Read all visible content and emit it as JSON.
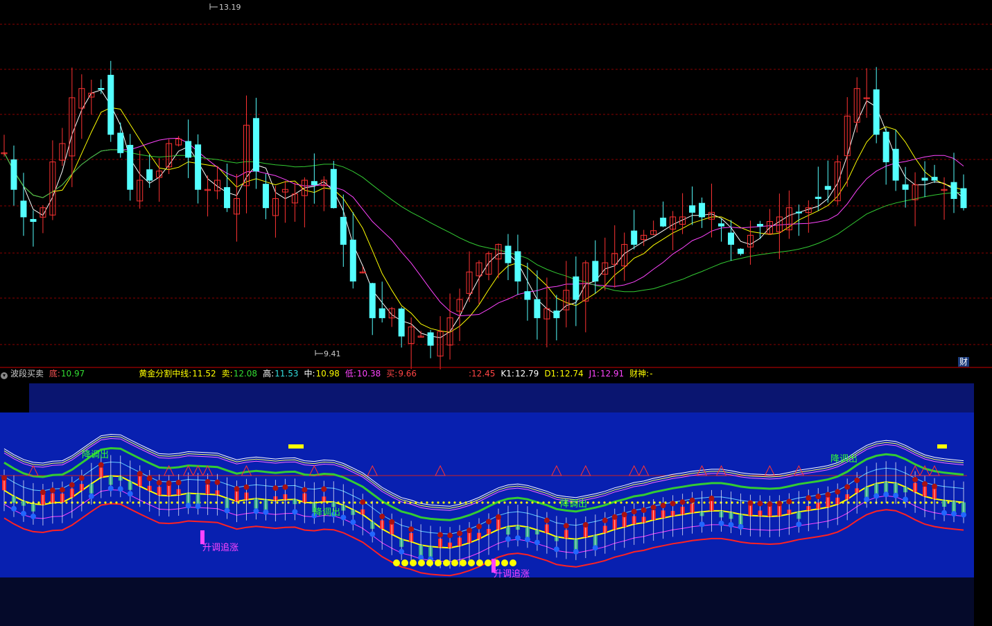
{
  "main_chart": {
    "high_label": "13.19",
    "low_label": "9.41",
    "side_badge": "财"
  },
  "indicator": {
    "name": "波段买卖",
    "items": [
      {
        "label": "底",
        "value": "10.97",
        "label_color": "#ff5555",
        "value_color": "#33dd33"
      },
      {
        "label": "黄金分割中线",
        "value": "11.52",
        "label_color": "#ffff00",
        "value_color": "#ffff00"
      },
      {
        "label": "卖",
        "value": "12.08",
        "label_color": "#ffff00",
        "value_color": "#33dd33"
      },
      {
        "label": "高",
        "value": "11.53",
        "label_color": "#ffffff",
        "value_color": "#33dddd"
      },
      {
        "label": "中",
        "value": "10.98",
        "label_color": "#ffffff",
        "value_color": "#ffff00"
      },
      {
        "label": "低",
        "value": "10.38",
        "label_color": "#ff44ff",
        "value_color": "#ff44ff"
      },
      {
        "label": "买",
        "value": "9.66",
        "label_color": "#ff4444",
        "value_color": "#ff4444"
      }
    ],
    "items2": [
      {
        "label": "",
        "value": ":12.45",
        "label_color": "#ff4444",
        "value_color": "#ff4444"
      },
      {
        "label": "K1",
        "value": "12.79",
        "label_color": "#ffffff",
        "value_color": "#ffffff"
      },
      {
        "label": "D1",
        "value": "12.74",
        "label_color": "#ffff00",
        "value_color": "#ffff00"
      },
      {
        "label": "J1",
        "value": "12.91",
        "label_color": "#ff44ff",
        "value_color": "#ff44ff"
      },
      {
        "label": "财神",
        "value": "-",
        "label_color": "#ffff00",
        "value_color": "#ffff00"
      }
    ]
  },
  "annotations": [
    {
      "text": "降调出",
      "color": "#33ff33"
    },
    {
      "text": "降调出",
      "color": "#33ff33"
    },
    {
      "text": "降调出",
      "color": "#33ff33"
    },
    {
      "text": "降调出",
      "color": "#33ff33"
    },
    {
      "text": "升调追涨",
      "color": "#ff44ff"
    },
    {
      "text": "升调追涨",
      "color": "#ff44ff"
    }
  ],
  "colors": {
    "up": "#ff3333",
    "down": "#54ffff",
    "ma5": "#ffffff",
    "ma10": "#ffff00",
    "ma20": "#ff44ff",
    "ma60": "#33cc33",
    "grid": "#8b0000",
    "panel_outer": "#0a1570",
    "panel_inner": "#0820b0"
  },
  "chart_data": {
    "type": "candlestick",
    "price_range": [
      9.41,
      13.19
    ],
    "series": [
      {
        "name": "",
        "values": [
          11.6,
          11.2,
          10.9,
          10.85,
          11.0,
          11.5,
          11.7,
          12.2,
          12.3,
          12.25,
          12.3,
          11.8,
          11.6,
          11.2,
          11.3,
          11.3,
          11.4,
          11.7,
          11.75,
          11.55,
          11.2,
          11.2,
          11.3,
          11.0,
          11.1,
          11.9,
          11.4,
          11.0,
          11.1,
          11.2,
          11.15,
          11.3,
          11.25,
          11.3,
          11.0,
          10.6,
          10.2,
          10.3,
          9.8,
          9.8,
          9.9,
          9.6,
          9.7,
          9.6,
          9.5,
          9.65,
          9.8,
          10.0,
          10.3,
          10.4,
          10.5,
          10.6,
          10.4,
          10.2,
          10.0,
          9.8,
          9.9,
          9.8,
          10.1,
          10.0,
          10.4,
          10.2,
          10.4,
          10.5,
          10.6,
          10.6,
          10.7,
          10.75,
          10.8,
          10.9,
          10.9,
          10.95,
          10.9,
          10.95,
          10.8,
          10.6,
          10.5,
          10.7,
          10.8,
          10.85,
          10.9,
          11.0,
          10.95,
          11.0,
          11.1,
          11.2,
          11.5,
          12.0,
          12.3,
          12.2,
          11.8,
          11.5,
          11.3,
          11.2,
          11.25,
          11.3,
          11.3,
          11.2,
          11.1,
          11.0
        ]
      }
    ]
  }
}
